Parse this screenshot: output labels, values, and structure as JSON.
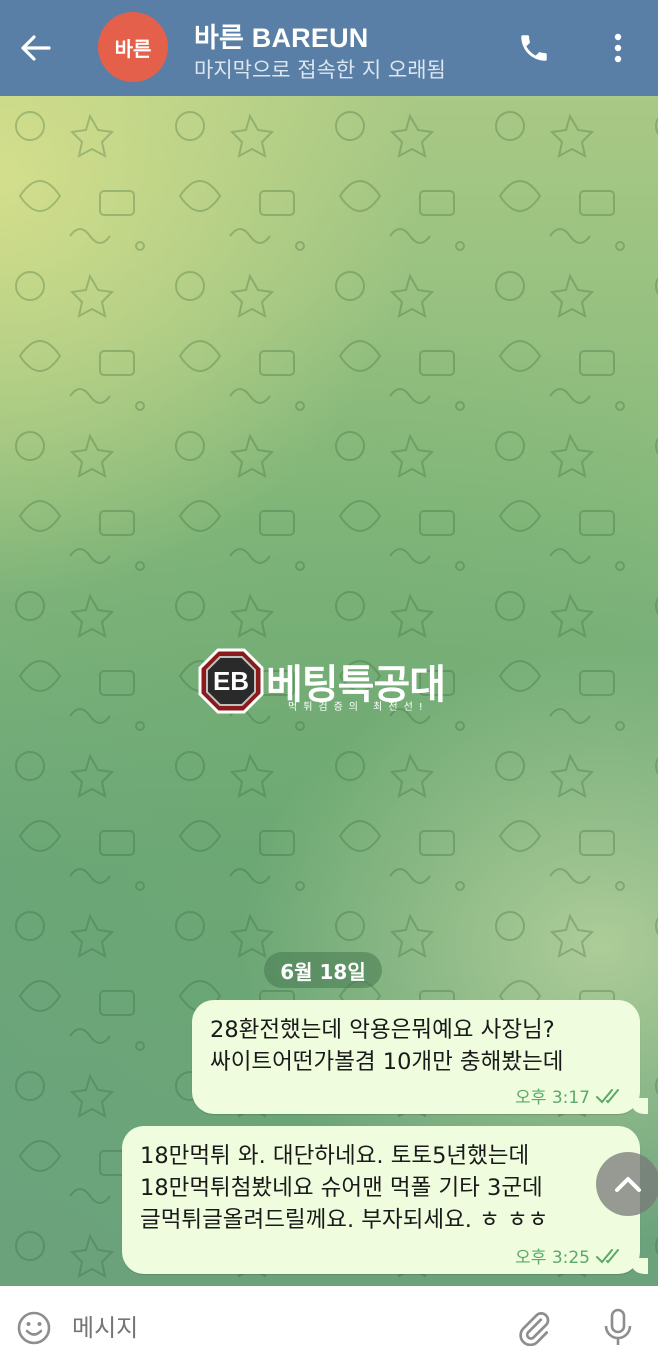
{
  "header": {
    "avatar_text": "바른",
    "title": "바른 BAREUN",
    "subtitle": "마지막으로 접속한 지 오래됨",
    "back_icon": "arrow-left-icon",
    "call_icon": "phone-icon",
    "more_icon": "more-vertical-icon",
    "bar_color": "#5a7fa6",
    "avatar_color": "#e5604a"
  },
  "watermark": {
    "logo_text": "EB",
    "name": "베팅특공대",
    "tagline": "먹튀검증의 최전선!"
  },
  "chat": {
    "date_label": "6월 18일",
    "messages": [
      {
        "lines": [
          "28환전했는데 악용은뭐예요 사장님?",
          "싸이트어떤가볼겸 10개만 충해봤는데"
        ],
        "time": "오후 3:17",
        "status": "double-check-icon"
      },
      {
        "lines": [
          "18만먹튀 와. 대단하네요. 토토5년했는데",
          "18만먹튀첨봤네요 슈어맨 먹폴 기타 3군데",
          "글먹튀글올려드릴께요.  부자되세요. ㅎ ㅎㅎ"
        ],
        "time": "오후 3:25",
        "status": "double-check-icon"
      }
    ],
    "bubble_color": "#effdde",
    "meta_color": "#5aa96a"
  },
  "scroll_button_icon": "chevron-up-icon",
  "composer": {
    "placeholder": "메시지",
    "emoji_icon": "smile-icon",
    "attach_icon": "paperclip-icon",
    "mic_icon": "microphone-icon"
  }
}
